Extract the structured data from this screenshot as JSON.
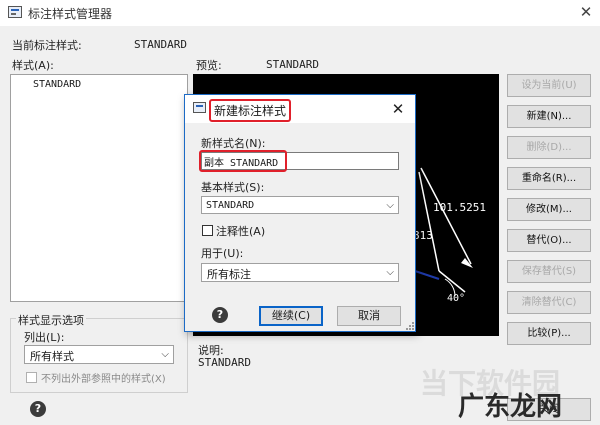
{
  "window": {
    "title": "标注样式管理器",
    "close_glyph": "✕"
  },
  "current_style": {
    "label": "当前标注样式:",
    "value": "STANDARD"
  },
  "styles": {
    "label": "样式(A):",
    "items": [
      "STANDARD"
    ]
  },
  "preview": {
    "label": "预览:",
    "value": "STANDARD",
    "dim_text": "101.5251",
    "angle_text": "40°",
    "partial_text": "813"
  },
  "buttons": {
    "set_current": "设为当前(U)",
    "new": "新建(N)...",
    "delete": "删除(D)...",
    "rename": "重命名(R)...",
    "modify": "修改(M)...",
    "override": "替代(O)...",
    "save_override": "保存替代(S)",
    "clear_override": "清除替代(C)",
    "compare": "比较(P)...",
    "close": "关闭"
  },
  "display_options": {
    "group_label": "样式显示选项",
    "list_label": "列出(L):",
    "list_value": "所有样式",
    "exclude_xref_label": "不列出外部参照中的样式(X)"
  },
  "description": {
    "label": "说明:",
    "value": "STANDARD"
  },
  "dialog": {
    "title": "新建标注样式",
    "new_name_label": "新样式名(N):",
    "new_name_value": "副本 STANDARD",
    "base_style_label": "基本样式(S):",
    "base_style_value": "STANDARD",
    "annotative_label": "注释性(A)",
    "use_for_label": "用于(U):",
    "use_for_value": "所有标注",
    "continue_label": "继续(C)",
    "cancel_label": "取消"
  },
  "watermark": {
    "line1": "当下软件园",
    "line2": "广东龙网"
  },
  "icons": {
    "help": "help-icon",
    "dropdown": "chevron-down-icon",
    "close": "close-icon"
  },
  "colors": {
    "highlight_box": "#e0202b",
    "dialog_border": "#1c6bc6",
    "preview_bg": "#000000"
  }
}
